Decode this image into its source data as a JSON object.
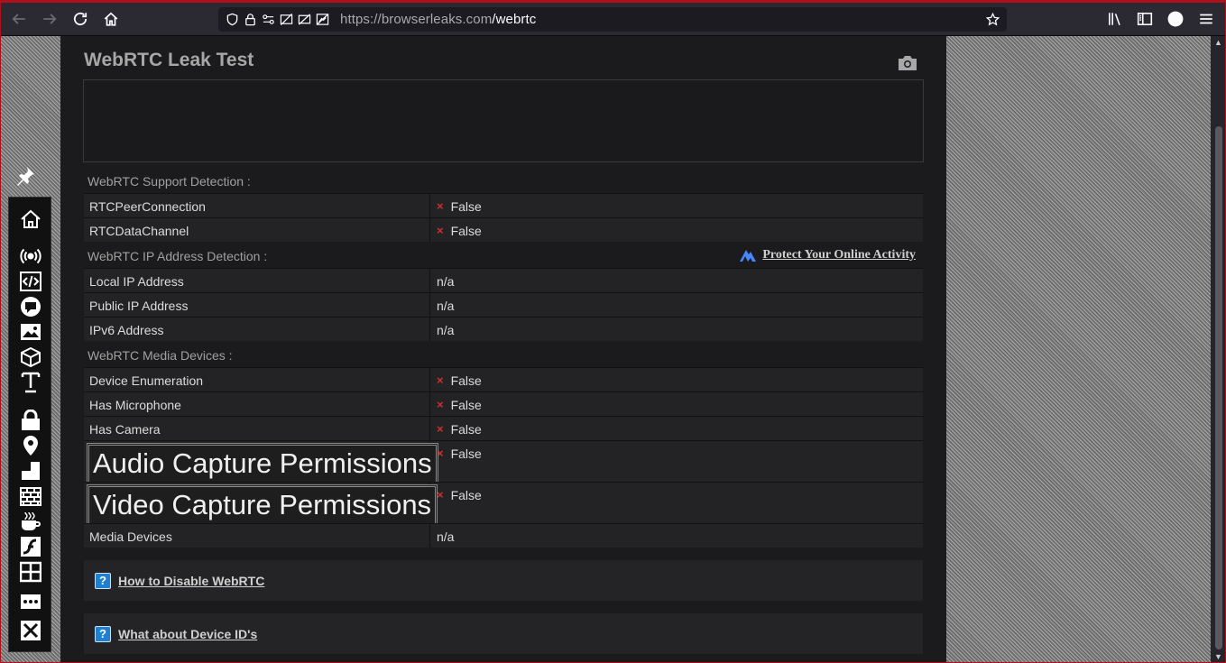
{
  "browser": {
    "url_host": "https://browserleaks.com",
    "url_path": "/webrtc"
  },
  "page": {
    "title": "WebRTC Leak Test",
    "support_section": {
      "heading": "WebRTC Support Detection :",
      "rows": [
        {
          "key": "RTCPeerConnection",
          "value": "False",
          "icon": "x-mark"
        },
        {
          "key": "RTCDataChannel",
          "value": "False",
          "icon": "x-mark"
        }
      ]
    },
    "ip_section": {
      "heading": "WebRTC IP Address Detection :",
      "protect_link": "Protect Your Online Activity",
      "rows": [
        {
          "key": "Local IP Address",
          "value": "n/a"
        },
        {
          "key": "Public IP Address",
          "value": "n/a"
        },
        {
          "key": "IPv6 Address",
          "value": "n/a"
        }
      ]
    },
    "media_section": {
      "heading": "WebRTC Media Devices :",
      "rows": [
        {
          "key": "Device Enumeration",
          "value": "False",
          "icon": "x-mark"
        },
        {
          "key": "Has Microphone",
          "value": "False",
          "icon": "x-mark"
        },
        {
          "key": "Has Camera",
          "value": "False",
          "icon": "x-mark"
        },
        {
          "key": "Audio Capture Permissions",
          "value": "False",
          "icon": "x-mark"
        },
        {
          "key": "Video Capture Permissions",
          "value": "False",
          "icon": "x-mark"
        },
        {
          "key": "Media Devices",
          "value": "n/a"
        }
      ]
    },
    "x_mark": "×",
    "info_links": [
      {
        "label": "How to Disable WebRTC",
        "icon": "?"
      },
      {
        "label": "What about Device ID's",
        "icon": "?"
      }
    ]
  },
  "sidebar_icons": [
    "home-icon",
    "broadcast-icon",
    "code-icon",
    "chat-icon",
    "image-icon",
    "cube-icon",
    "font-icon",
    "lock-icon",
    "map-pin-icon",
    "square-icon",
    "brick-wall-icon",
    "coffee-icon",
    "flash-icon",
    "grid-icon",
    "more-icon",
    "tools-icon"
  ],
  "colors": {
    "accent_red": "#d0302f",
    "window_border": "#b0101b",
    "info_blue": "#1f7fd1"
  }
}
